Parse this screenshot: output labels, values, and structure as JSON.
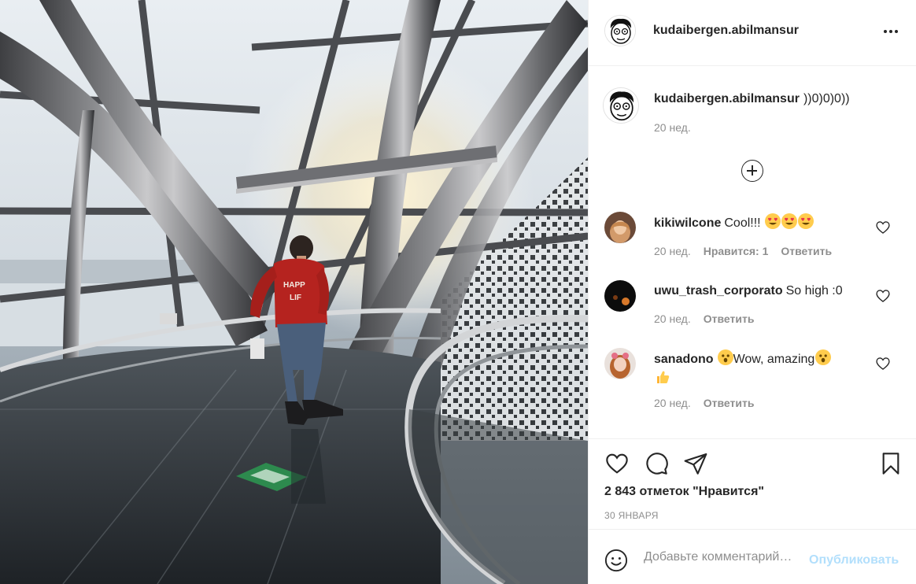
{
  "post": {
    "username": "kudaibergen.abilmansur",
    "more_icon": "more-horizontal-icon",
    "photo_alt": ""
  },
  "caption": {
    "username": "kudaibergen.abilmansur",
    "text": "))0)0)0))",
    "time": "20 нед."
  },
  "load_more_icon": "plus-circle-icon",
  "comments": [
    {
      "username": "kikiwilcone",
      "text": "Cool!!!",
      "emojis": [
        "heart-eyes-emoji",
        "heart-eyes-emoji",
        "heart-eyes-emoji"
      ],
      "time": "20 нед.",
      "likes": "Нравится: 1",
      "reply": "Ответить"
    },
    {
      "username": "uwu_trash_corporato",
      "text": "So high :0",
      "emojis": [],
      "time": "20 нед.",
      "likes": "",
      "reply": "Ответить"
    },
    {
      "username": "sanadono",
      "text": "Wow, amazing",
      "emojis": [
        "astonished-emoji",
        "astonished-emoji",
        "thumbs-up-emoji"
      ],
      "time": "20 нед.",
      "likes": "",
      "reply": "Ответить"
    }
  ],
  "actions": {
    "like_icon": "heart-icon",
    "comment_icon": "comment-icon",
    "share_icon": "paper-plane-icon",
    "save_icon": "bookmark-icon",
    "likes_text": "2 843 отметок \"Нравится\"",
    "date": "30 ЯНВАРЯ"
  },
  "add_comment": {
    "placeholder": "Добавьте комментарий…",
    "post_label": "Опубликовать",
    "emoji_icon": "smile-icon"
  },
  "colors": {
    "text": "#262626",
    "secondary": "#8e8e8e",
    "border": "#efefef",
    "post_disabled": "#b2dffc"
  }
}
